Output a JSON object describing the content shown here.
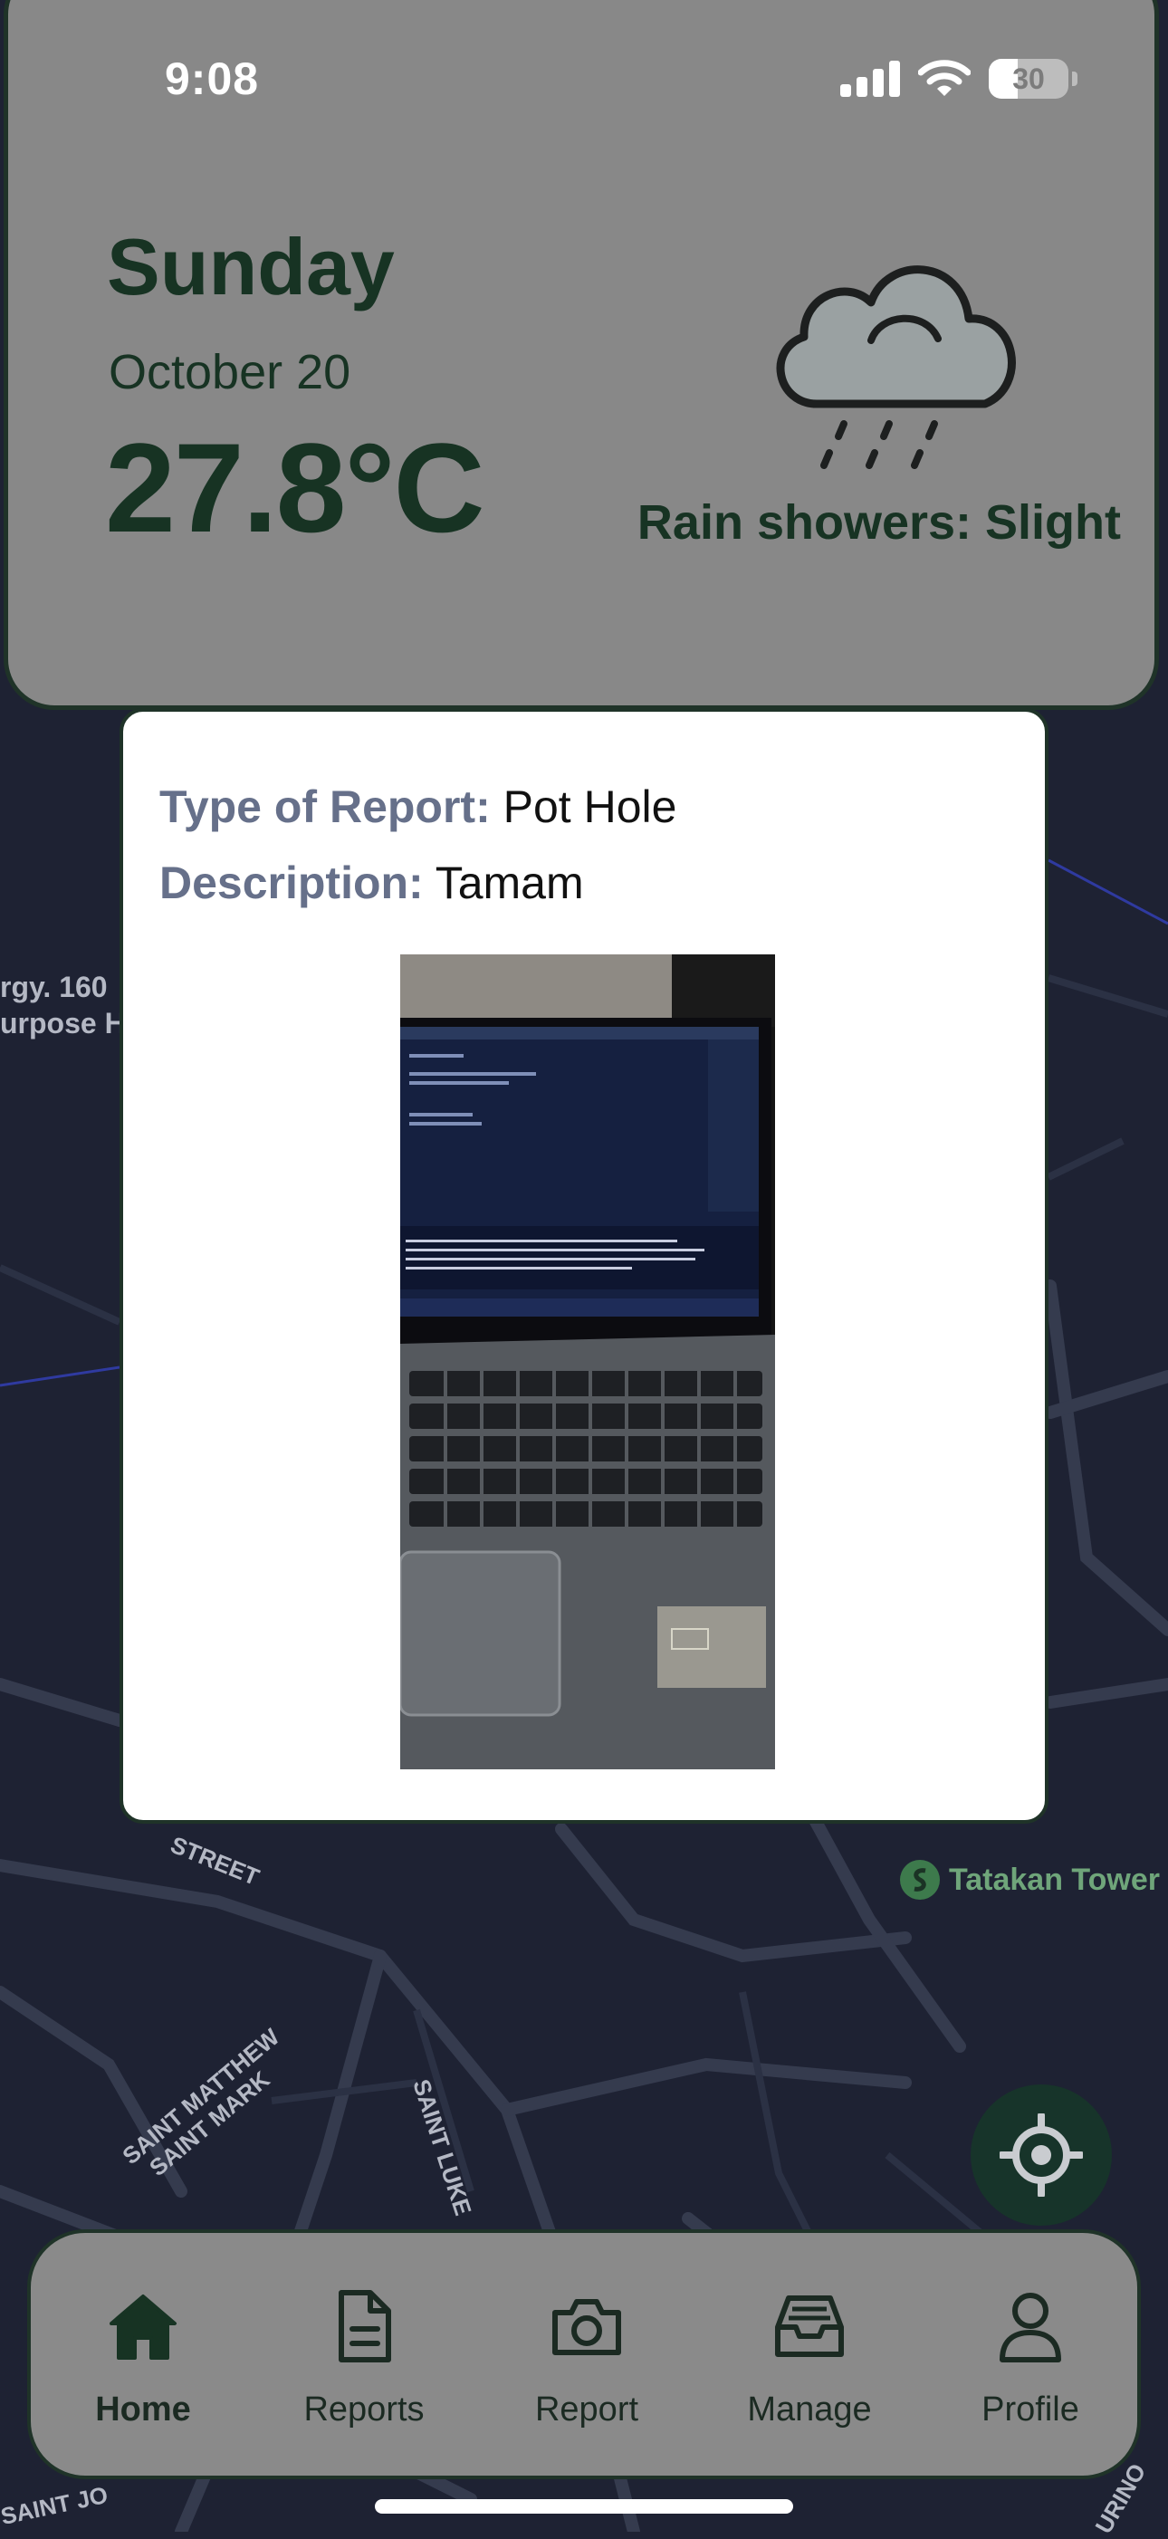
{
  "status_bar": {
    "time": "9:08",
    "battery": "30"
  },
  "weather": {
    "day": "Sunday",
    "date": "October 20",
    "temperature": "27.8°C",
    "condition": "Rain showers: Slight",
    "icon": "rain-cloud-icon"
  },
  "report_popup": {
    "type_label": "Type of Report:",
    "type_value": "Pot Hole",
    "description_label": "Description:",
    "description_value": "Tamam",
    "photo_icon": "laptop-photo"
  },
  "map": {
    "labels": {
      "poi_1": "rgy. 160",
      "poi_2": "urpose H",
      "tower": "Tatakan Tower",
      "street_1": "STREET",
      "street_2": "SAINT MATTHEW",
      "street_3": "SAINT MARK",
      "street_4": "SAINT LUKE",
      "street_5": "SAINT JO",
      "street_6": "URINO"
    }
  },
  "nav": {
    "items": [
      {
        "label": "Home",
        "icon": "home-icon",
        "active": true
      },
      {
        "label": "Reports",
        "icon": "document-icon",
        "active": false
      },
      {
        "label": "Report",
        "icon": "camera-icon",
        "active": false
      },
      {
        "label": "Manage",
        "icon": "inbox-icon",
        "active": false
      },
      {
        "label": "Profile",
        "icon": "user-icon",
        "active": false
      }
    ]
  },
  "colors": {
    "map_bg": "#1e2233",
    "card_bg": "#888888",
    "accent_dark": "#173323",
    "label_gray": "#66708a"
  }
}
